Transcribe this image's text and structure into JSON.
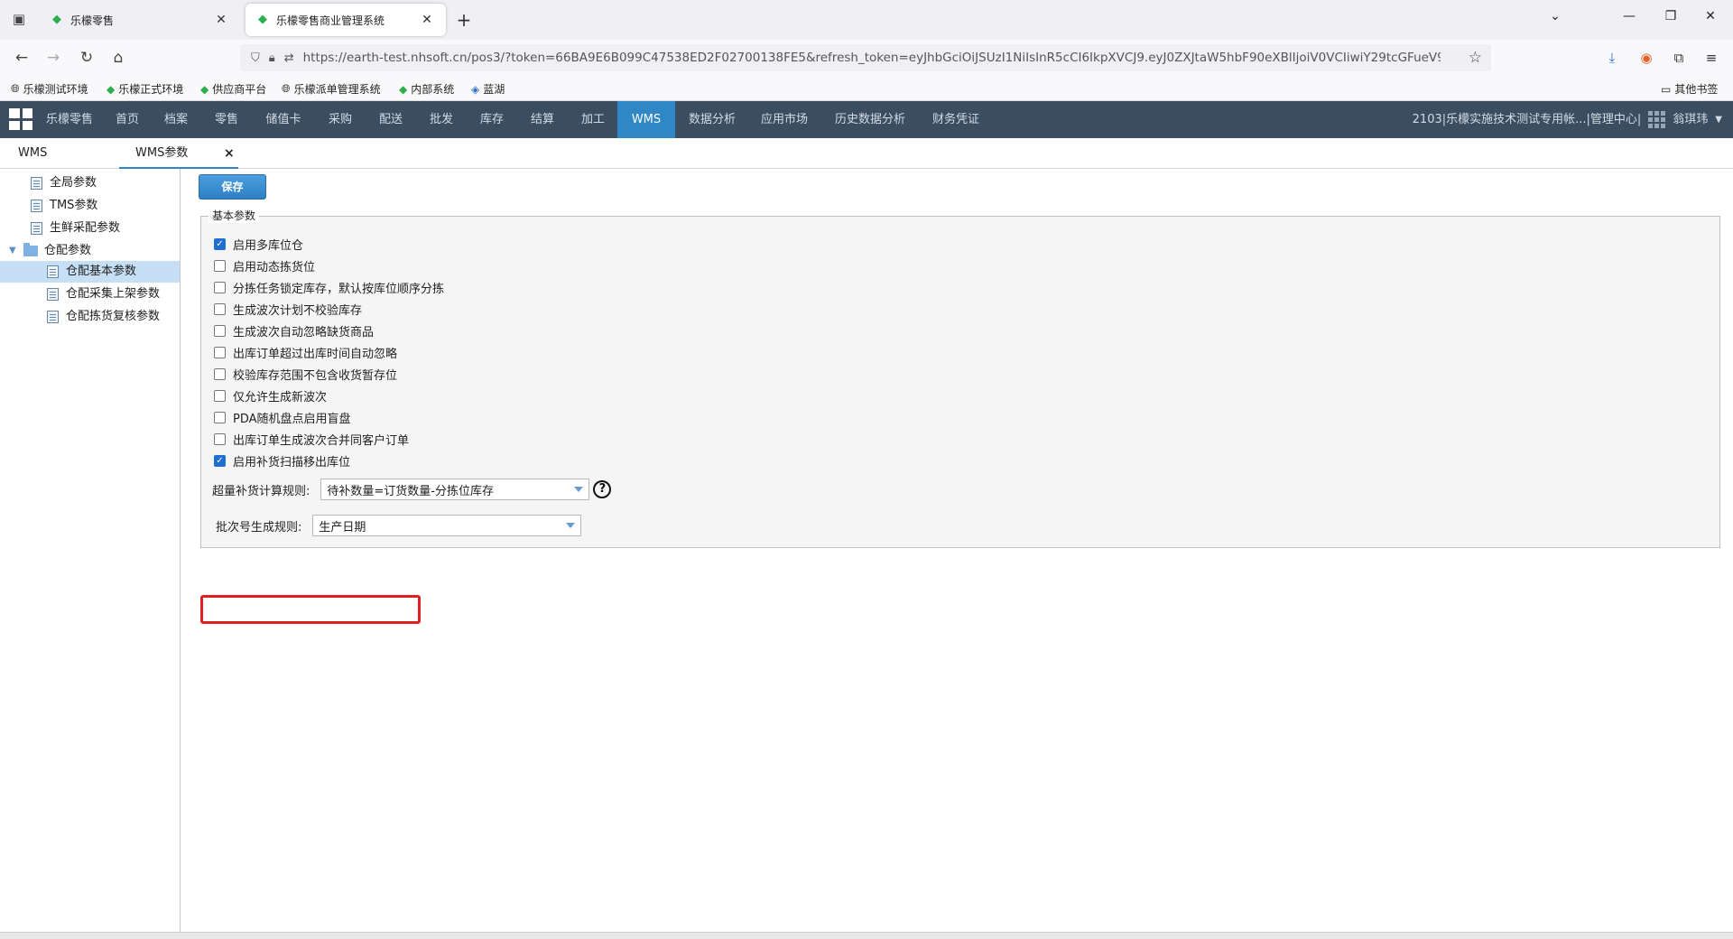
{
  "browser": {
    "tabs": [
      {
        "title": "乐檬零售"
      },
      {
        "title": "乐檬零售商业管理系统"
      }
    ],
    "url": "https://earth-test.nhsoft.cn/pos3/?token=66BA9E6B099C47538ED2F02700138FE5&refresh_token=eyJhbGciOiJSUzI1NiIsInR5cCI6IkpXVCJ9.eyJ0ZXJtaW5hbF90eXBlIjoiV0VCIiwiY29tcGFueV9pZC",
    "bookmarks": [
      "乐檬测试环境",
      "乐檬正式环境",
      "供应商平台",
      "乐檬派单管理系统",
      "内部系统",
      "蓝湖"
    ],
    "other_bookmarks": "其他书签"
  },
  "app": {
    "menu": [
      "乐檬零售",
      "首页",
      "档案",
      "零售",
      "储值卡",
      "采购",
      "配送",
      "批发",
      "库存",
      "结算",
      "加工",
      "WMS",
      "数据分析",
      "应用市场",
      "历史数据分析",
      "财务凭证"
    ],
    "active_menu": "WMS",
    "org": "2103|乐檬实施技术测试专用帐...|管理中心|",
    "user": "翁琪玮"
  },
  "page_tabs": [
    {
      "label": "WMS"
    },
    {
      "label": "WMS参数"
    }
  ],
  "sidebar": {
    "items": [
      {
        "label": "全局参数"
      },
      {
        "label": "TMS参数"
      },
      {
        "label": "生鲜采配参数"
      },
      {
        "label": "仓配参数"
      },
      {
        "label": "仓配基本参数"
      },
      {
        "label": "仓配采集上架参数"
      },
      {
        "label": "仓配拣货复核参数"
      }
    ]
  },
  "main": {
    "save_label": "保存",
    "section_title": "基本参数",
    "options": [
      {
        "label": "启用多库位仓",
        "checked": true
      },
      {
        "label": "启用动态拣货位",
        "checked": false
      },
      {
        "label": "分拣任务锁定库存，默认按库位顺序分拣",
        "checked": false
      },
      {
        "label": "生成波次计划不校验库存",
        "checked": false
      },
      {
        "label": "生成波次自动忽略缺货商品",
        "checked": false
      },
      {
        "label": "出库订单超过出库时间自动忽略",
        "checked": false
      },
      {
        "label": "校验库存范围不包含收货暂存位",
        "checked": false
      },
      {
        "label": "仅允许生成新波次",
        "checked": false
      },
      {
        "label": "PDA随机盘点启用盲盘",
        "checked": false
      },
      {
        "label": "出库订单生成波次合并同客户订单",
        "checked": false
      },
      {
        "label": "启用补货扫描移出库位",
        "checked": true
      }
    ],
    "replenish_rule": {
      "label": "超量补货计算规则:",
      "value": "待补数量=订货数量-分拣位库存"
    },
    "batch_rule": {
      "label": "批次号生成规则:",
      "value": "生产日期"
    }
  },
  "colors": {
    "header": "#3a4d61",
    "active_menu": "#2f87c6",
    "highlight": "#e02020",
    "check": "#1f6fd1"
  }
}
